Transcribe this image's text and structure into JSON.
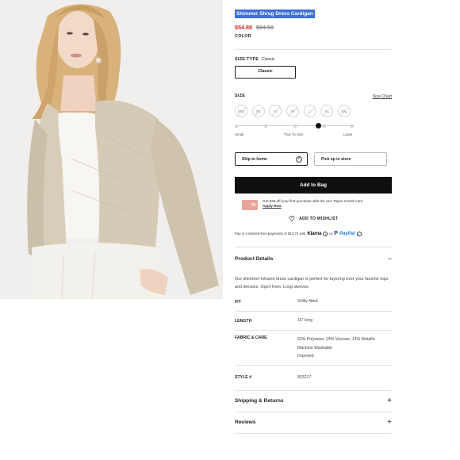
{
  "product": {
    "title": "Shimmer Shrug Dress Cardigan",
    "sale_price": "$54.88",
    "original_price": "$84.50",
    "color_label": "COLOR"
  },
  "size_type": {
    "label": "SIZE TYPE",
    "value": "Classic",
    "option": "Classic"
  },
  "size": {
    "label": "SIZE",
    "chart_link": "Size Chart",
    "options": [
      "XXS",
      "XS",
      "S",
      "M",
      "L",
      "XL",
      "XXL"
    ]
  },
  "fit_scale": {
    "labels": [
      "Small",
      "True To Size",
      "Large"
    ],
    "position": 0.7
  },
  "fulfillment": {
    "ship": "Ship to home",
    "pickup": "Pick up in store"
  },
  "add_to_bag": "Add to Bag",
  "promo": {
    "text": "Get $30 off your first purchase with the Ann Taylor Credit Card",
    "link": "Apply Now"
  },
  "wishlist": "ADD TO WISHLIST",
  "payments": {
    "text": "Pay in 4 interest-free payments of $13.72 with",
    "klarna": "Klarna",
    "or": "or",
    "paypal": "PayPal"
  },
  "product_details": {
    "heading": "Product Details",
    "toggle": "−",
    "description": "Our shimmer-infused dress cardigan is perfect for layering over your favorite tops and dresses. Open front. Long sleeves.",
    "specs": [
      {
        "key": "FIT",
        "value": "Softly fitted"
      },
      {
        "key": "LENGTH",
        "value": "16\" long"
      },
      {
        "key": "FABRIC & CARE",
        "lines": [
          "62% Polyester, 24% Viscose, 14% Metallic",
          "Machine Washable",
          "Imported"
        ]
      },
      {
        "key": "STYLE #",
        "value": "833217"
      }
    ]
  },
  "accordions": [
    {
      "label": "Shipping & Returns",
      "icon": "+"
    },
    {
      "label": "Reviews",
      "icon": "+"
    }
  ]
}
